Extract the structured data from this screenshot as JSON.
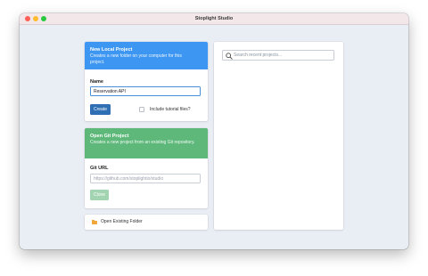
{
  "window": {
    "title": "Stoplight Studio"
  },
  "new_local_project": {
    "heading": "New Local Project",
    "description": "Creates a new folder on your computer for this project.",
    "name_label": "Name",
    "name_value": "Reservation API",
    "create_label": "Create",
    "include_tutorial_label": "Include tutorial files?",
    "include_tutorial_checked": false
  },
  "open_git_project": {
    "heading": "Open Git Project",
    "description": "Creates a new project from an existing Git repository.",
    "url_label": "Git URL",
    "url_placeholder": "https://github.com/stoplightio/studio",
    "clone_label": "Clone"
  },
  "open_existing_folder": {
    "label": "Open Existing Folder",
    "icon": "folder-icon"
  },
  "recent_projects": {
    "search_placeholder": "Search recent projects..."
  },
  "colors": {
    "accent_blue": "#3d96f2",
    "accent_green": "#5db87a",
    "button_blue": "#2f6fb4",
    "button_disabled_green": "#a3d4b2",
    "folder_orange": "#f0a63a"
  }
}
